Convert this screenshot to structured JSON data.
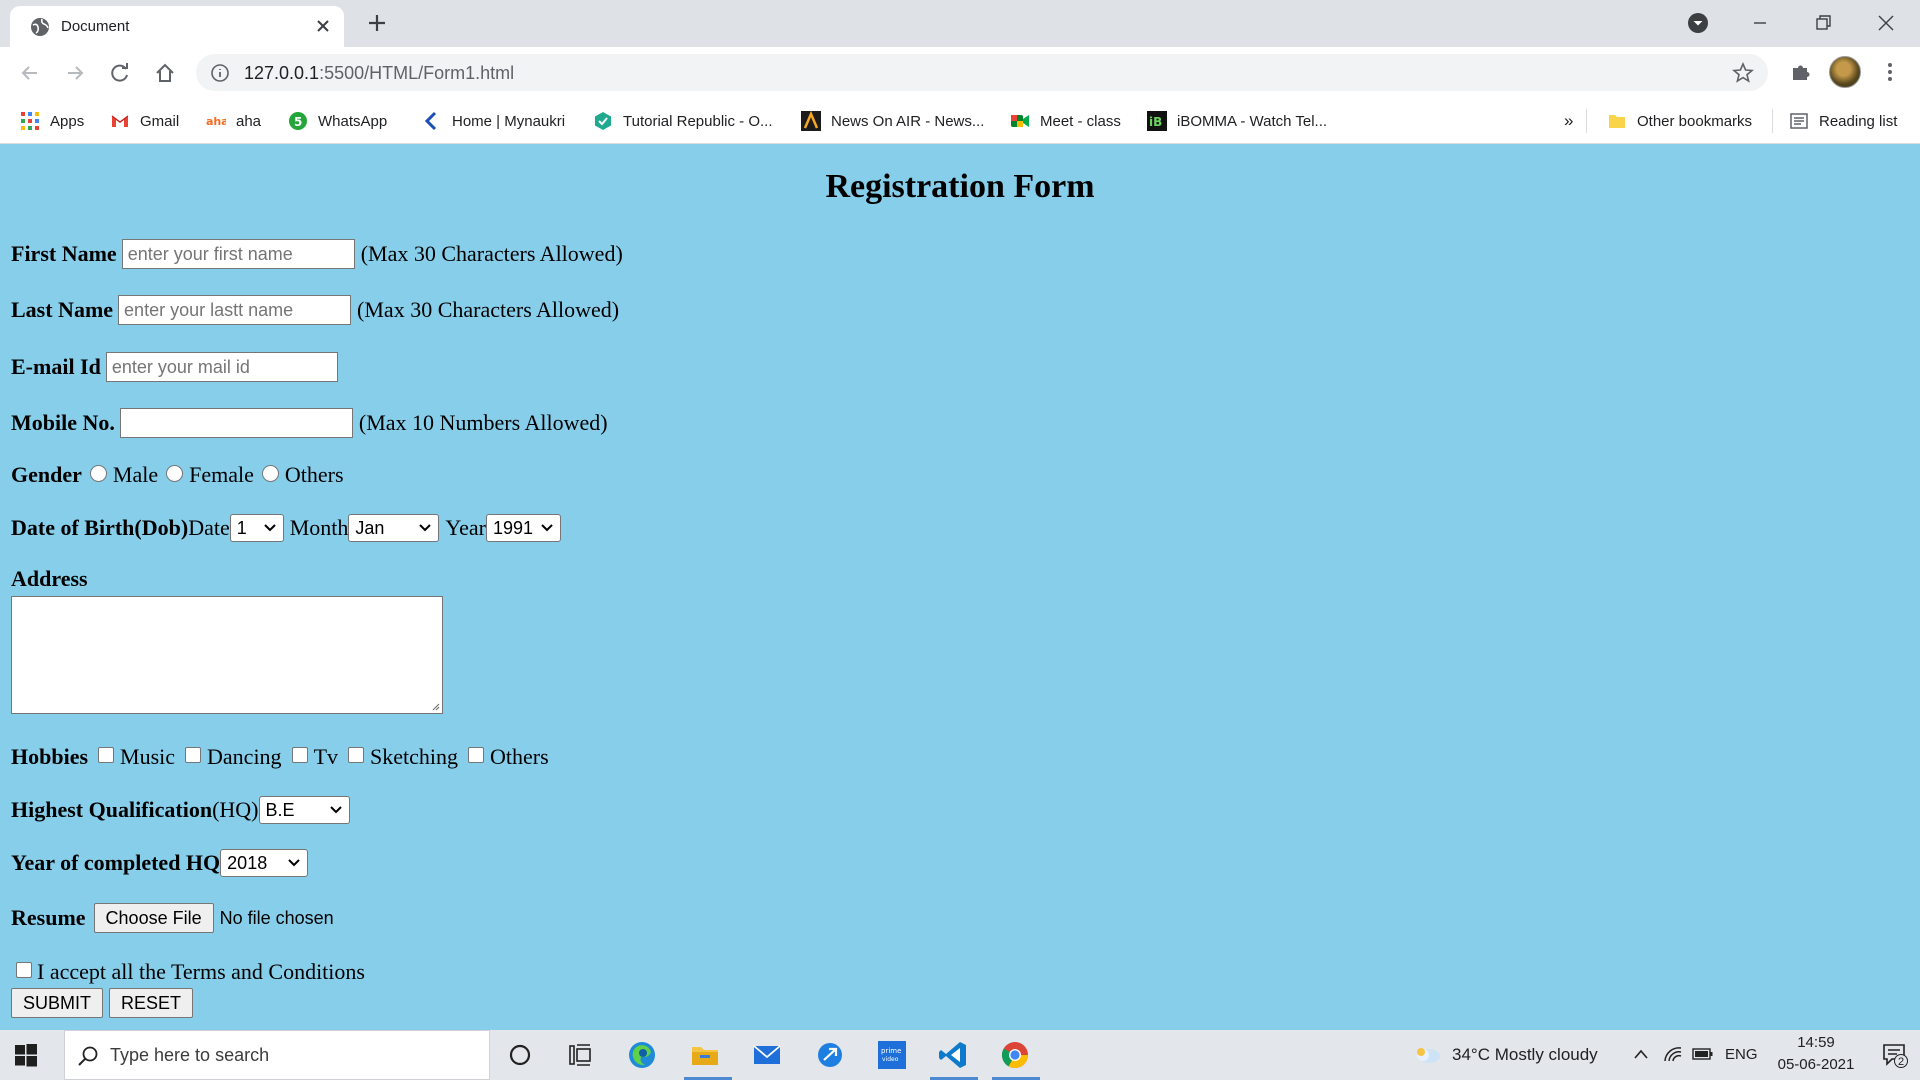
{
  "browser": {
    "tab_title": "Document",
    "url_host": "127.0.0.1",
    "url_rest": ":5500/HTML/Form1.html",
    "bookmarks": [
      {
        "label": "Apps",
        "icon": "apps-grid-icon"
      },
      {
        "label": "Gmail",
        "icon": "gmail-icon"
      },
      {
        "label": "aha",
        "icon": "aha-icon"
      },
      {
        "label": "WhatsApp",
        "icon": "whatsapp-icon"
      },
      {
        "label": "Home | Mynaukri",
        "icon": "mynaukri-icon"
      },
      {
        "label": "Tutorial Republic - O...",
        "icon": "tutorial-republic-icon"
      },
      {
        "label": "News On AIR - News...",
        "icon": "news-on-air-icon"
      },
      {
        "label": "Meet - class",
        "icon": "google-meet-icon"
      },
      {
        "label": "iBOMMA - Watch Tel...",
        "icon": "ibomma-icon"
      }
    ],
    "overflow_label": "»",
    "other_bookmarks": "Other bookmarks",
    "reading_list": "Reading list"
  },
  "form": {
    "title": "Registration Form",
    "first_name": {
      "label": "First Name",
      "placeholder": "enter your first name",
      "hint": "(Max 30 Characters Allowed)"
    },
    "last_name": {
      "label": "Last Name",
      "placeholder": "enter your lastt name",
      "hint": "(Max 30 Characters Allowed)"
    },
    "email": {
      "label": "E-mail Id",
      "placeholder": "enter your mail id"
    },
    "mobile": {
      "label": "Mobile No.",
      "placeholder": "",
      "hint": "(Max 10 Numbers Allowed)"
    },
    "gender": {
      "label": "Gender",
      "options": [
        "Male",
        "Female",
        "Others"
      ]
    },
    "dob": {
      "label": "Date of Birth(Dob)",
      "date_label": "Date",
      "date_value": "1",
      "month_label": "Month",
      "month_value": "Jan",
      "year_label": "Year",
      "year_value": "1991"
    },
    "address": {
      "label": "Address"
    },
    "hobbies": {
      "label": "Hobbies",
      "options": [
        "Music",
        "Dancing",
        "Tv",
        "Sketching",
        "Others"
      ]
    },
    "qualification": {
      "label": "Highest Qualification",
      "label_suffix": "(HQ)",
      "value": "B.E"
    },
    "year_completed": {
      "label": "Year of completed HQ",
      "value": "2018"
    },
    "resume": {
      "label": "Resume",
      "button": "Choose File",
      "status": "No file chosen"
    },
    "terms": "I accept all the Terms and Conditions",
    "submit": "SUBMIT",
    "reset": "RESET"
  },
  "taskbar": {
    "search_placeholder": "Type here to search",
    "weather": "34°C  Mostly cloudy",
    "language": "ENG",
    "time": "14:59",
    "date": "05-06-2021",
    "notifications": "2"
  },
  "colors": {
    "page_background": "#87ceeb",
    "taskbar_active": "#4d8ad1"
  }
}
